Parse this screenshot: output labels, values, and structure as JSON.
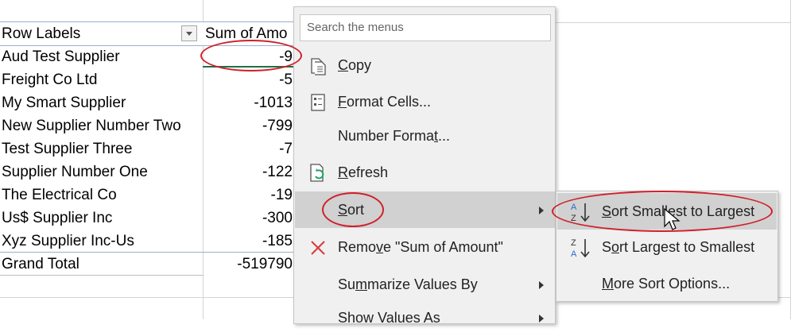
{
  "pivot": {
    "header": {
      "row_labels": "Row Labels",
      "sum_col": "Sum of Amo"
    },
    "rows": [
      {
        "label": "Aud Test Supplier",
        "value": "-9"
      },
      {
        "label": "Freight Co Ltd",
        "value": "-5"
      },
      {
        "label": "My Smart Supplier",
        "value": "-1013"
      },
      {
        "label": "New Supplier Number Two",
        "value": "-799"
      },
      {
        "label": "Test Supplier Three",
        "value": "-7"
      },
      {
        "label": "Supplier Number One",
        "value": "-122"
      },
      {
        "label": "The Electrical Co",
        "value": "-19"
      },
      {
        "label": "Us$ Supplier Inc",
        "value": "-300"
      },
      {
        "label": "Xyz Supplier Inc-Us",
        "value": "-185"
      }
    ],
    "grand_total": {
      "label": "Grand Total",
      "value": "-519790"
    }
  },
  "menu": {
    "search_placeholder": "Search the menus",
    "items": [
      {
        "pre": "",
        "u": "C",
        "post": "opy",
        "icon": "copy-icon"
      },
      {
        "pre": "",
        "u": "F",
        "post": "ormat Cells...",
        "icon": "format-cells-icon"
      },
      {
        "pre": "Number Forma",
        "u": "t",
        "post": "...",
        "icon": ""
      },
      {
        "pre": "",
        "u": "R",
        "post": "efresh",
        "icon": "refresh-icon"
      },
      {
        "pre": "",
        "u": "S",
        "post": "ort",
        "icon": ""
      },
      {
        "pre": "Remo",
        "u": "v",
        "post": "e \"Sum of Amount\"",
        "icon": "remove-icon"
      },
      {
        "pre": "Su",
        "u": "m",
        "post": "marize Values By",
        "icon": ""
      },
      {
        "pre": "Show Values As",
        "u": "",
        "post": "",
        "icon": ""
      }
    ]
  },
  "submenu": {
    "items": [
      {
        "pre": "",
        "u": "S",
        "post": "ort Smallest to Largest",
        "icon": "sort-a-to-z-icon"
      },
      {
        "pre": "S",
        "u": "o",
        "post": "rt Largest to Smallest",
        "icon": "sort-z-to-a-icon"
      },
      {
        "pre": "",
        "u": "M",
        "post": "ore Sort Options...",
        "icon": ""
      }
    ]
  },
  "colors": {
    "annotation": "#d0202a",
    "selection": "#1e7145",
    "refresh_green": "#21a366",
    "remove_red": "#d83b3b"
  }
}
